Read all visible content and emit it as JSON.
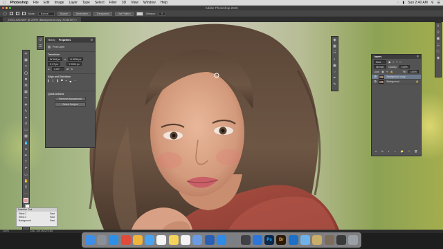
{
  "menubar": {
    "app": "Photoshop",
    "items": [
      "File",
      "Edit",
      "Image",
      "Layer",
      "Type",
      "Select",
      "Filter",
      "3D",
      "View",
      "Window",
      "Help"
    ],
    "clock": "Sun 2:40 AM"
  },
  "titlebar": {
    "title": "Adobe Photoshop 2020"
  },
  "options": {
    "mode_label": "Mode:",
    "mode_value": "Normal",
    "btn1": "Source",
    "btn2": "Destination",
    "btn3": "Transparent",
    "btn4": "Use Pattern",
    "diffusion_label": "Diffusion:",
    "diffusion_value": "5"
  },
  "document": {
    "tab": "_DSC1028.NEF @ 200% (Background copy, RGB/16*) ×",
    "zoom": "200%",
    "doc_info": "Doc: 139.1M/278.6M"
  },
  "properties": {
    "tabs": [
      "History",
      "Properties"
    ],
    "kind": "Pixel Layer",
    "transform_title": "Transform",
    "w": "W 184 px",
    "h": "H 3936 px",
    "x": "X 47 px",
    "y": "Y 2001 px",
    "angle": "0.00°",
    "align_title": "Align and Distribute",
    "quick_title": "Quick Actions",
    "remove_bg": "Remove Background",
    "select_subject": "Select Subject"
  },
  "layers": {
    "title": "Layers",
    "kind": "Kind",
    "blend": "Normal",
    "opacity_label": "Opacity:",
    "opacity": "100%",
    "lock_label": "Lock:",
    "fill_label": "Fill:",
    "fill": "100%",
    "items": [
      {
        "name": "Background copy",
        "selected": true
      },
      {
        "name": "Background",
        "selected": false
      }
    ]
  },
  "swatches": {
    "title": "Selective Tool",
    "rows": [
      [
        "Effect 2",
        "Best"
      ],
      [
        "Effect 3",
        "Best"
      ],
      [
        "Background",
        "Best"
      ]
    ]
  },
  "dock": {
    "apps": [
      {
        "name": "finder-icon",
        "color": "#3f8ee6",
        "glyph": ""
      },
      {
        "name": "launchpad-icon",
        "color": "#8a8f99",
        "glyph": ""
      },
      {
        "name": "safari-icon",
        "color": "#2e8fe8",
        "glyph": ""
      },
      {
        "name": "chrome-icon",
        "color": "#e04a3b",
        "glyph": ""
      },
      {
        "name": "photos-icon",
        "color": "#f0b33c",
        "glyph": ""
      },
      {
        "name": "mail-icon",
        "color": "#4aa3ee",
        "glyph": ""
      },
      {
        "name": "calendar-icon",
        "color": "#f4f4f4",
        "glyph": ""
      },
      {
        "name": "notes-icon",
        "color": "#f3d35b",
        "glyph": ""
      },
      {
        "name": "reminders-icon",
        "color": "#f2f2f2",
        "glyph": ""
      },
      {
        "name": "drive-icon",
        "color": "#6b9be0",
        "glyph": ""
      },
      {
        "name": "word-icon",
        "color": "#2b5fb3",
        "glyph": ""
      },
      {
        "name": "appstore-icon",
        "color": "#2f8ae8",
        "glyph": ""
      },
      {
        "name": "settings-icon",
        "color": "#7b7f86",
        "glyph": ""
      },
      {
        "name": "screenshot-icon",
        "color": "#3f4146",
        "glyph": ""
      },
      {
        "name": "bluetooth-icon",
        "color": "#2b76d8",
        "glyph": ""
      },
      {
        "name": "photoshop-icon",
        "color": "#0b2a4a",
        "glyph": "Ps"
      },
      {
        "name": "bridge-icon",
        "color": "#2a1a0a",
        "glyph": "Br"
      },
      {
        "name": "outlook-icon",
        "color": "#1d6fc7",
        "glyph": ""
      },
      {
        "name": "folder-icon",
        "color": "#6fb2ea",
        "glyph": ""
      },
      {
        "name": "preview-icon",
        "color": "#c9ad6a",
        "glyph": ""
      },
      {
        "name": "dropbox-icon",
        "color": "#7b6c5c",
        "glyph": ""
      },
      {
        "name": "document-icon",
        "color": "#3a3a3a",
        "glyph": ""
      },
      {
        "name": "trash-icon",
        "color": "#9aa0a6",
        "glyph": ""
      }
    ]
  }
}
